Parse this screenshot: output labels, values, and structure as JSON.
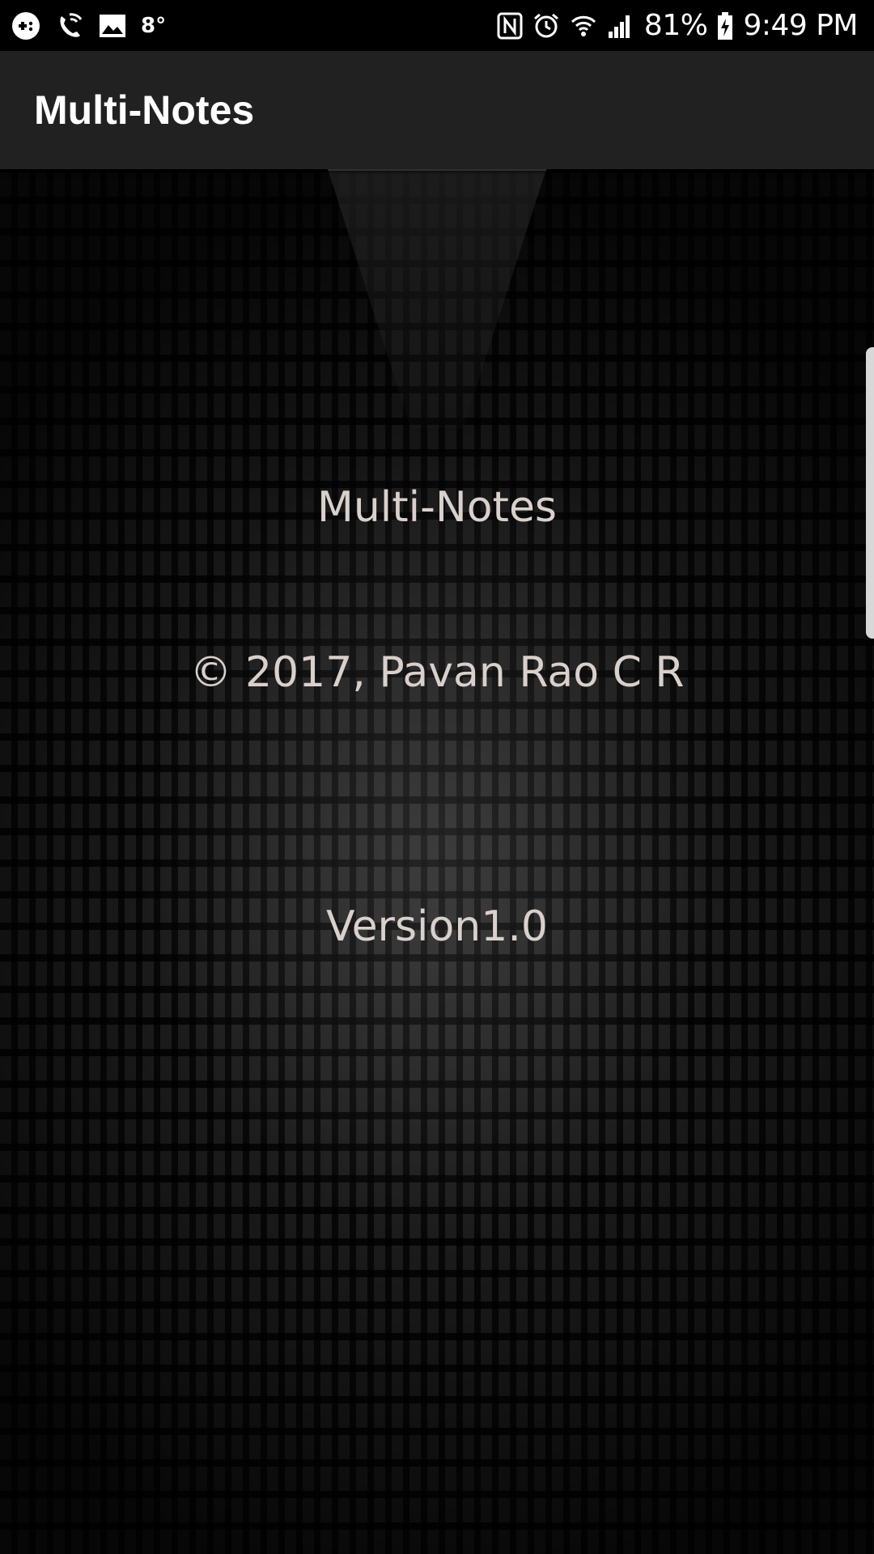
{
  "status_bar": {
    "temperature": "8°",
    "battery_percent": "81%",
    "time": "9:49 PM",
    "icons_left": [
      "game-controller-icon",
      "wifi-call-icon",
      "image-icon"
    ],
    "icons_right": [
      "nfc-icon",
      "alarm-icon",
      "wifi-icon",
      "cell-signal-icon",
      "battery-charging-icon"
    ]
  },
  "app_bar": {
    "title": "Multi-Notes"
  },
  "about": {
    "app_name": "Multi-Notes",
    "copyright": "© 2017, Pavan Rao C R",
    "version": "Version1.0"
  },
  "colors": {
    "app_bar_bg": "#212121",
    "text_color": "#d9d0cc",
    "status_bar_bg": "#000000"
  }
}
